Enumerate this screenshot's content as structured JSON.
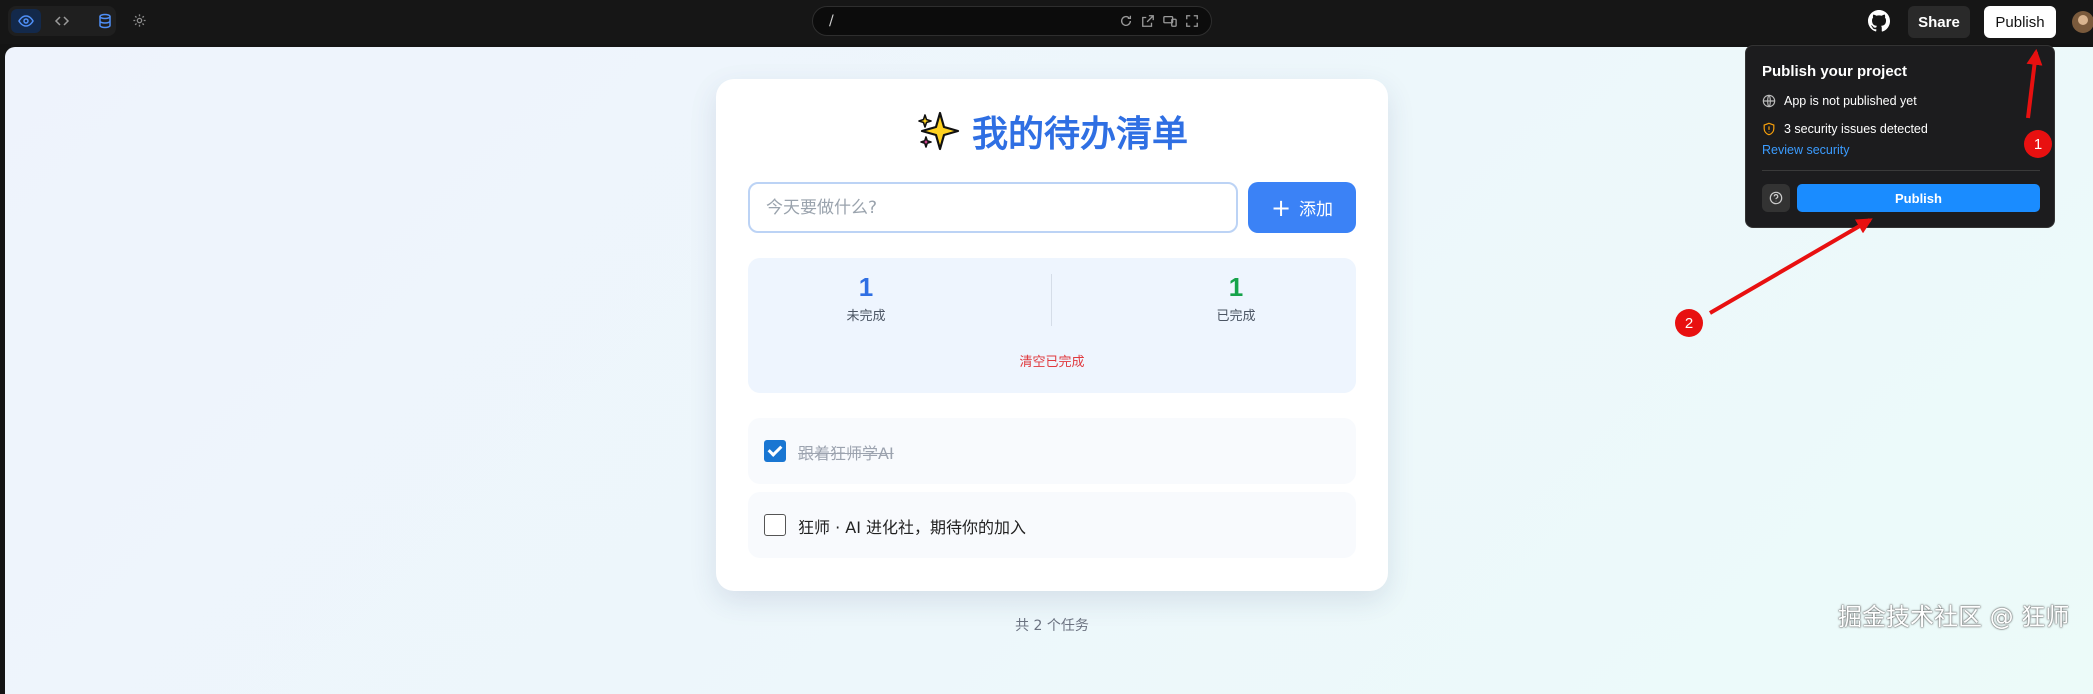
{
  "toolbar": {
    "tools": [
      "preview-icon",
      "code-icon",
      "database-icon"
    ],
    "settings_icon": "gear-icon"
  },
  "url_bar": {
    "path": "/"
  },
  "header": {
    "share_label": "Share",
    "publish_label": "Publish"
  },
  "app": {
    "title_icon": "sparkles-icon",
    "title": "我的待办清单",
    "input_placeholder": "今天要做什么?",
    "add_label": "添加",
    "stats": {
      "pending_count": "1",
      "pending_label": "未完成",
      "done_count": "1",
      "done_label": "已完成",
      "clear_label": "清空已完成"
    },
    "todos": [
      {
        "text": "跟着狂师学AI",
        "done": true
      },
      {
        "text": "狂师 · AI 进化社，期待你的加入",
        "done": false
      }
    ],
    "footer": "共 2 个任务"
  },
  "popover": {
    "title": "Publish your project",
    "status_text": "App is not published yet",
    "security_text": "3 security issues detected",
    "review_link": "Review security",
    "publish_label": "Publish"
  },
  "annotations": {
    "step1": "1",
    "step2": "2"
  },
  "watermark": "掘金技术社区 @ 狂师",
  "colors": {
    "accent_blue": "#3b82f6",
    "title_blue": "#2f6fe3",
    "done_green": "#16a34a",
    "danger_red": "#e0393e",
    "popover_publish": "#1a8cff",
    "annotation_red": "#e81010"
  }
}
